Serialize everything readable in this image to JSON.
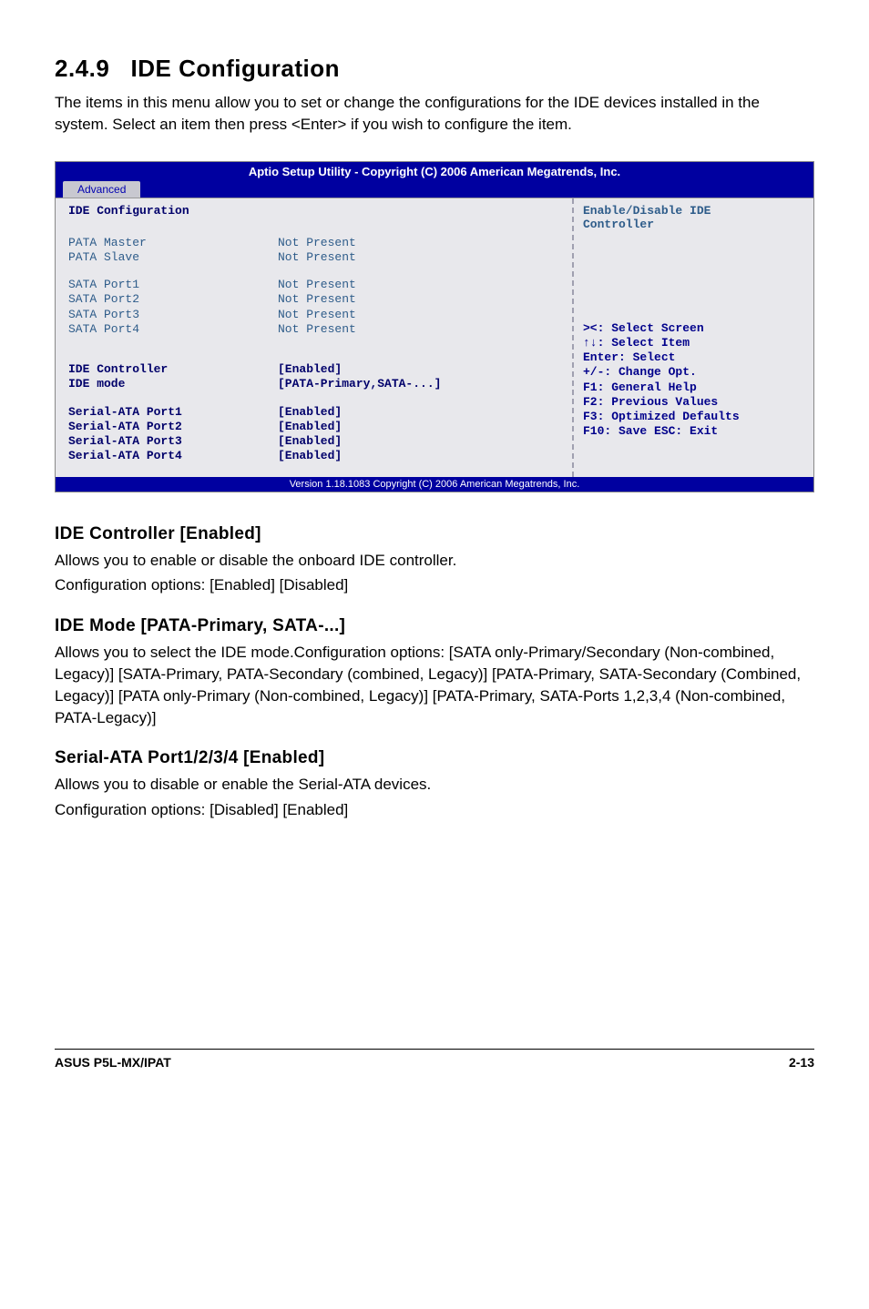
{
  "section": {
    "number": "2.4.9",
    "title": "IDE Configuration",
    "intro": "The items in this menu allow you to set or change the configurations for the IDE devices installed in the system. Select an item then press <Enter> if you wish to configure the item."
  },
  "bios": {
    "header": "Aptio Setup Utility - Copyright (C) 2006 American Megatrends, Inc.",
    "tab": "Advanced",
    "main_heading": "IDE Configuration",
    "rows": [
      {
        "label": "PATA Master",
        "value": "Not Present",
        "bold": false
      },
      {
        "label": "PATA Slave",
        "value": "Not Present",
        "bold": false
      }
    ],
    "rows2": [
      {
        "label": "SATA Port1",
        "value": "Not Present",
        "bold": false
      },
      {
        "label": "SATA Port2",
        "value": "Not Present",
        "bold": false
      },
      {
        "label": "SATA Port3",
        "value": "Not Present",
        "bold": false
      },
      {
        "label": "SATA Port4",
        "value": "Not Present",
        "bold": false
      }
    ],
    "rows3": [
      {
        "label": "IDE Controller",
        "value": "[Enabled]",
        "bold": true
      },
      {
        "label": "IDE mode",
        "value": "[PATA-Primary,SATA-...]",
        "bold": true
      }
    ],
    "rows4": [
      {
        "label": "Serial-ATA Port1",
        "value": "[Enabled]",
        "bold": true
      },
      {
        "label": "Serial-ATA Port2",
        "value": "[Enabled]",
        "bold": true
      },
      {
        "label": "Serial-ATA Port3",
        "value": "[Enabled]",
        "bold": true
      },
      {
        "label": "Serial-ATA Port4",
        "value": "[Enabled]",
        "bold": true
      }
    ],
    "right_help1": "Enable/Disable IDE",
    "right_help2": "Controller",
    "nav": [
      "><: Select Screen",
      "↑↓: Select Item",
      "Enter: Select",
      "+/-: Change Opt.",
      "F1: General Help",
      "F2: Previous Values",
      "F3: Optimized Defaults",
      "F10: Save  ESC: Exit"
    ],
    "footer": "Version 1.18.1083 Copyright (C) 2006 American Megatrends, Inc."
  },
  "subsections": [
    {
      "heading": "IDE Controller [Enabled]",
      "lines": [
        "Allows you to enable or disable the onboard IDE controller.",
        "Configuration options: [Enabled] [Disabled]"
      ]
    },
    {
      "heading": "IDE Mode [PATA-Primary, SATA-...]",
      "lines": [
        "Allows you to select the IDE mode.Configuration options: [SATA only-Primary/Secondary (Non-combined, Legacy)] [SATA-Primary, PATA-Secondary (combined, Legacy)] [PATA-Primary, SATA-Secondary (Combined, Legacy)] [PATA only-Primary (Non-combined, Legacy)] [PATA-Primary, SATA-Ports 1,2,3,4 (Non-combined, PATA-Legacy)]"
      ]
    },
    {
      "heading": "Serial-ATA Port1/2/3/4 [Enabled]",
      "lines": [
        "Allows you to disable or enable the Serial-ATA devices.",
        "Configuration options: [Disabled] [Enabled]"
      ]
    }
  ],
  "footer": {
    "left": "ASUS P5L-MX/IPAT",
    "right": "2-13"
  }
}
